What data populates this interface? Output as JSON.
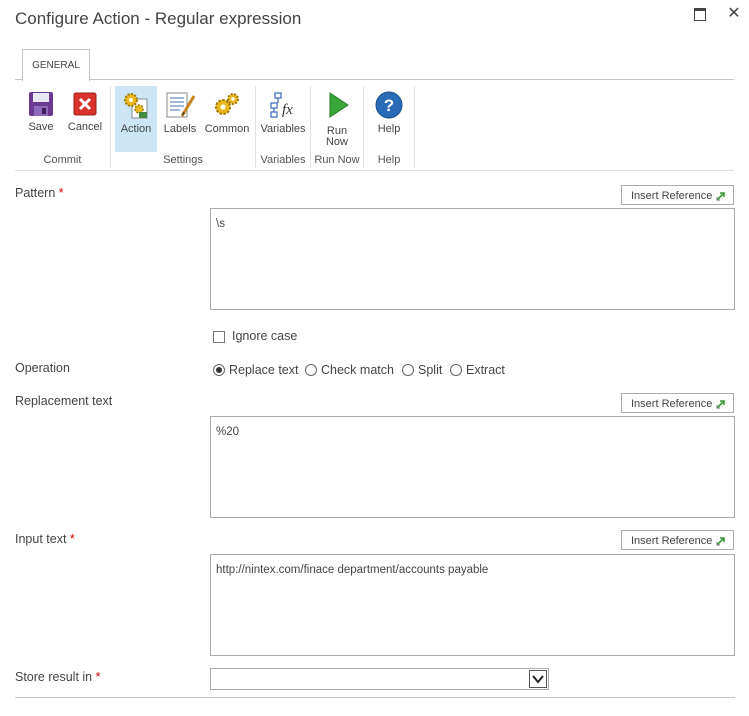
{
  "dialog": {
    "title": "Configure Action - Regular expression",
    "maximize_icon": "maximize-icon",
    "close_icon": "close-icon",
    "close_glyph": "✕"
  },
  "ribbon": {
    "tab": "GENERAL",
    "buttons": {
      "save": "Save",
      "cancel": "Cancel",
      "action": "Action",
      "labels": "Labels",
      "common": "Common",
      "variables": "Variables",
      "run_now_line1": "Run",
      "run_now_line2": "Now",
      "help": "Help"
    },
    "groups": {
      "commit": "Commit",
      "settings": "Settings",
      "variables": "Variables",
      "run_now": "Run Now",
      "help": "Help"
    },
    "active_button": "Action"
  },
  "form": {
    "required_mark": "*",
    "insert_reference": "Insert Reference",
    "pattern": {
      "label": "Pattern",
      "value": "\\s"
    },
    "ignore_case": {
      "label": "Ignore case",
      "checked": false
    },
    "operation": {
      "label": "Operation",
      "options": [
        "Replace text",
        "Check match",
        "Split",
        "Extract"
      ],
      "selected": "Replace text"
    },
    "replacement": {
      "label": "Replacement text",
      "value": "%20"
    },
    "input": {
      "label": "Input text",
      "value": "http://nintex.com/finace department/accounts payable"
    },
    "store_result": {
      "label": "Store result in",
      "value": ""
    }
  },
  "colors": {
    "accent_active": "#cde6f7",
    "required": "#cc0000",
    "border": "#ababab"
  }
}
